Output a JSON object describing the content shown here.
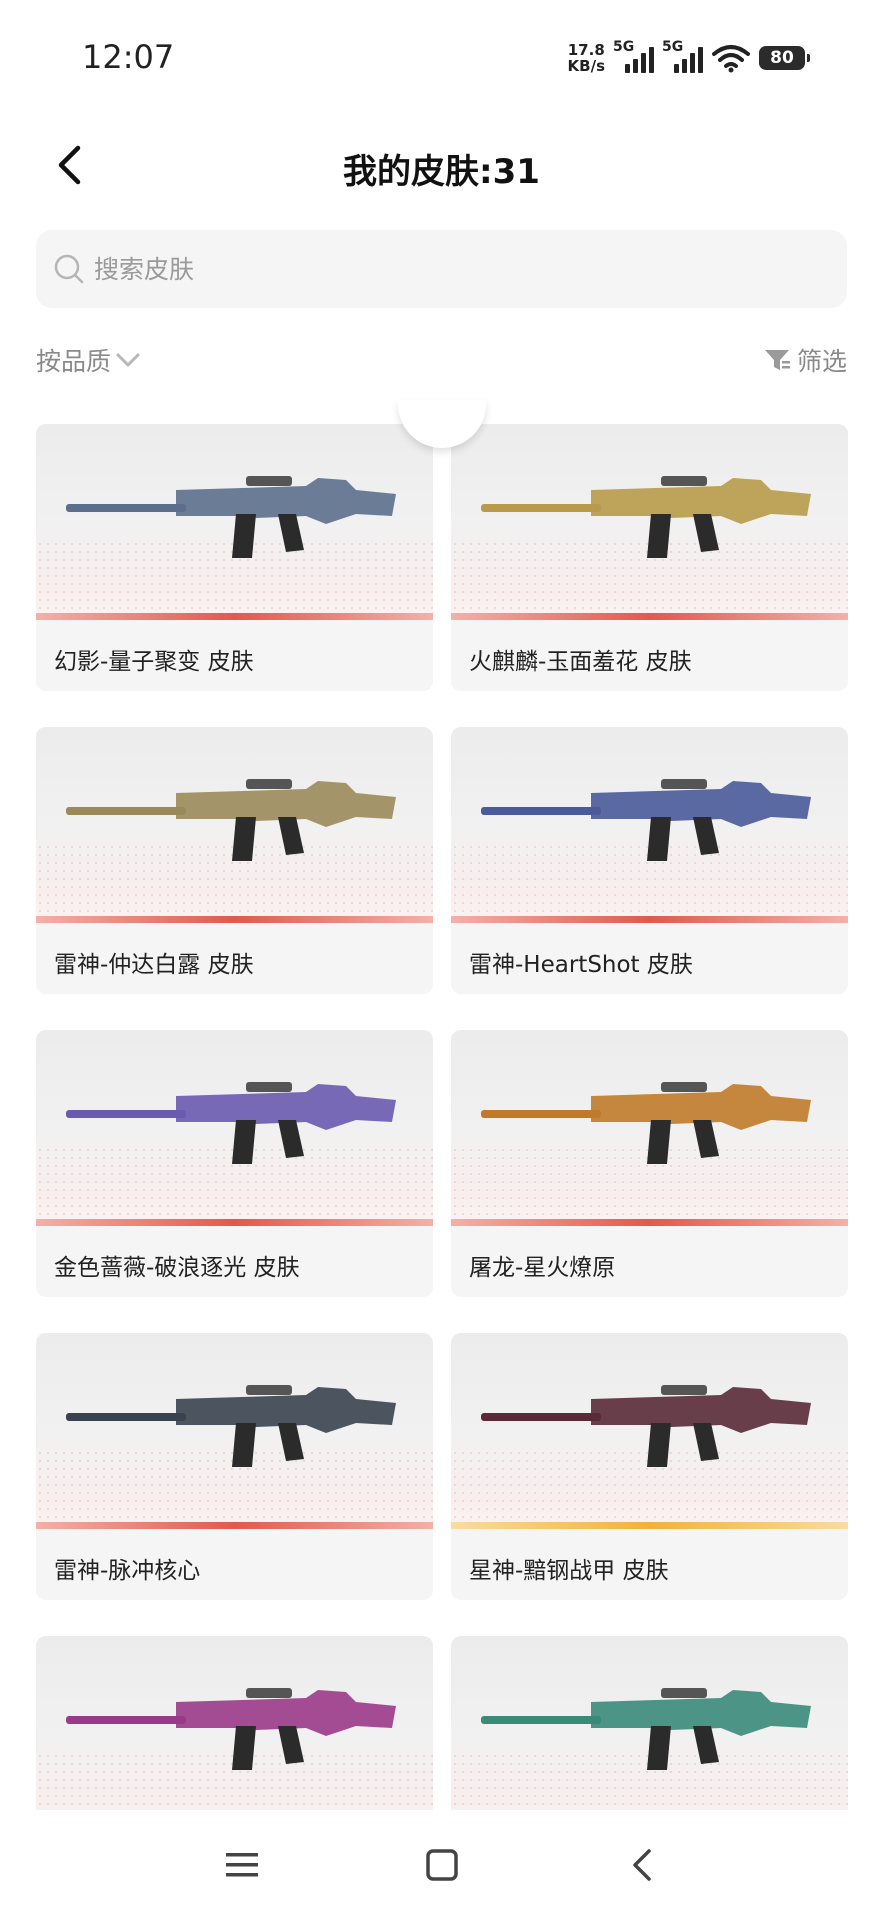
{
  "status_bar": {
    "time": "12:07",
    "net_speed_value": "17.8",
    "net_speed_unit": "KB/s",
    "sim1": "5G",
    "sim2": "5G",
    "battery": "80"
  },
  "header": {
    "title": "我的皮肤:31"
  },
  "search": {
    "placeholder": "搜索皮肤"
  },
  "filters": {
    "sort_label": "按品质",
    "filter_label": "筛选"
  },
  "skins": [
    {
      "name": "幻影-量子聚变 皮肤",
      "rarity_color": "#e05a4c",
      "gun_color": "#5b6f8c"
    },
    {
      "name": "火麒麟-玉面羞花 皮肤",
      "rarity_color": "#e05a4c",
      "gun_color": "#b89a4a"
    },
    {
      "name": "雷神-仲达白露 皮肤",
      "rarity_color": "#e05a4c",
      "gun_color": "#9a8a5a"
    },
    {
      "name": "雷神-HeartShot 皮肤",
      "rarity_color": "#e05a4c",
      "gun_color": "#4a5a9a"
    },
    {
      "name": "金色蔷薇-破浪逐光 皮肤",
      "rarity_color": "#e05a4c",
      "gun_color": "#6a5ab0"
    },
    {
      "name": "屠龙-星火燎原",
      "rarity_color": "#e05a4c",
      "gun_color": "#c07a2a"
    },
    {
      "name": "雷神-脉冲核心",
      "rarity_color": "#e05a4c",
      "gun_color": "#3a4250"
    },
    {
      "name": "星神-黯钢战甲 皮肤",
      "rarity_color": "#f2b23a",
      "gun_color": "#5a2a38"
    },
    {
      "name": "",
      "rarity_color": "#e05a4c",
      "gun_color": "#9a3a8a"
    },
    {
      "name": "",
      "rarity_color": "#e05a4c",
      "gun_color": "#3a8a7a"
    }
  ],
  "icons": {
    "back": "chevron-left-icon",
    "search": "search-icon",
    "sort": "chevron-down-icon",
    "filter": "filter-icon",
    "menu": "menu-icon",
    "home": "home-icon",
    "nav_back": "back-icon"
  }
}
